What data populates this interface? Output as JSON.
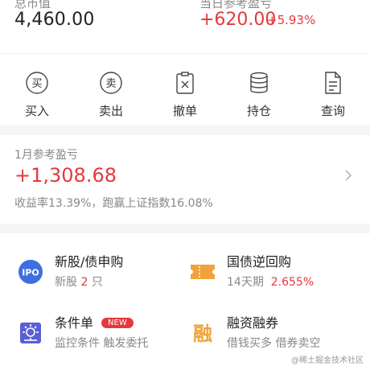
{
  "summary": {
    "market_value_label": "总市值",
    "market_value": "4,460.00",
    "daily_pl_label": "当日参考盈亏",
    "daily_pl": "+620.00",
    "daily_pl_pct": "+5.93%"
  },
  "actions": [
    {
      "label": "买入",
      "icon": "buy-icon",
      "glyph": "买"
    },
    {
      "label": "卖出",
      "icon": "sell-icon",
      "glyph": "卖"
    },
    {
      "label": "撤单",
      "icon": "cancel-order-icon"
    },
    {
      "label": "持仓",
      "icon": "holdings-icon"
    },
    {
      "label": "查询",
      "icon": "query-icon"
    }
  ],
  "monthly": {
    "title": "1月参考盈亏",
    "value": "+1,308.68",
    "return_label": "收益率",
    "return_value": "13.39%",
    "beat_label": "跑赢上证指数",
    "beat_value": "16.08%"
  },
  "services": {
    "ipo": {
      "icon_text": "IPO",
      "title": "新股/债申购",
      "sub_prefix": "新股",
      "count": "2",
      "sub_suffix": "只"
    },
    "repo": {
      "title": "国债逆回购",
      "term": "14天期",
      "rate": "2.655%"
    },
    "conditional": {
      "title": "条件单",
      "badge": "NEW",
      "sub": "监控条件 触发委托"
    },
    "margin": {
      "icon_text": "融",
      "title": "融资融券",
      "sub": "借钱买多 借券卖空"
    }
  },
  "watermark": "@稀土掘金技术社区",
  "colors": {
    "up": "#e4393c",
    "orange": "#f0a33a",
    "blue": "#3d6fe0",
    "bg_gap": "#f5f5f7"
  }
}
